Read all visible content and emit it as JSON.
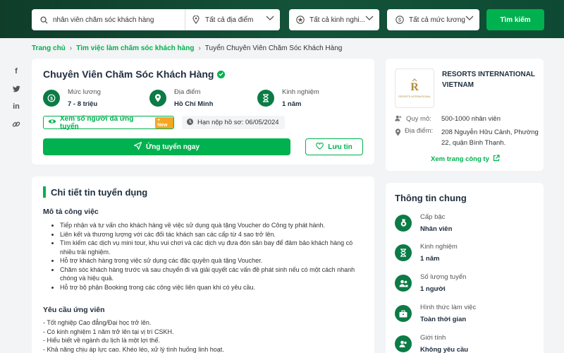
{
  "search": {
    "keyword": "nhân viên chăm sóc khách hàng",
    "location": "Tất cả địa điểm",
    "industry": "Tất cả kinh nghi...",
    "salary": "Tất cả mức lương",
    "button": "Tìm kiếm"
  },
  "breadcrumb": [
    "Trang chủ",
    "Tìm việc làm chăm sóc khách hàng",
    "Tuyển Chuyên Viên Chăm Sóc Khách Hàng"
  ],
  "job": {
    "title": "Chuyên Viên Chăm Sóc Khách Hàng",
    "stats": [
      {
        "label": "Mức lương",
        "value": "7 - 8 triệu",
        "icon": "salary-icon"
      },
      {
        "label": "Địa điểm",
        "value": "Hồ Chí Minh",
        "icon": "location-icon"
      },
      {
        "label": "Kinh nghiệm",
        "value": "1 năm",
        "icon": "hourglass-icon"
      }
    ],
    "view_applicants": "Xem số người đã ứng tuyển",
    "new_badge": "New",
    "deadline": "Hạn nộp hồ sơ: 06/05/2024",
    "apply": "Ứng tuyển ngay",
    "save": "Lưu tin"
  },
  "detail": {
    "heading": "Chi tiết tin tuyển dụng",
    "desc_title": "Mô tả công việc",
    "desc_items": [
      "Tiếp nhận và tư vấn cho khách hàng về việc sử dụng quà tặng Voucher do Công ty phát hành.",
      "Liên kết và thương lượng với các đối tác khách sạn các cấp từ 4 sao trở lên.",
      "Tìm kiếm các dịch vụ mini tour, khu vui chơi và các dịch vụ đưa đón sân bay để đảm bảo khách hàng có nhiều trải nghiệm.",
      "Hỗ trợ khách hàng trong việc sử dụng các đặc quyền quà tặng Voucher.",
      "Chăm sóc khách hàng trước và sau chuyến đi và giải quyết các vấn đề phát sinh nếu có một cách nhanh chóng và hiệu quả.",
      "Hỗ trợ bộ phận Booking trong các công việc liên quan khi có yêu cầu."
    ],
    "req_title": "Yêu cầu ứng viên",
    "req_items": [
      "- Tốt nghiệp Cao đẳng/Đại học trở lên.",
      "- Có kinh nghiệm 1 năm trở lên tại vị trí CSKH.",
      "- Hiểu biết về ngành du lịch là một lợi thế.",
      "- Khả năng chịu áp lực cao. Khéo léo, xử lý tình huống linh hoạt."
    ]
  },
  "company": {
    "name": "RESORTS INTERNATIONAL VIETNAM",
    "logo_text": "RESORTS INTERNATIONAL",
    "size_label": "Quy mô:",
    "size": "500-1000 nhân viên",
    "address_label": "Địa điểm:",
    "address": "208 Nguyễn Hữu Cảnh, Phường 22, quận Bình Thạnh.",
    "link": "Xem trang công ty"
  },
  "general": {
    "title": "Thông tin chung",
    "items": [
      {
        "label": "Cấp bậc",
        "value": "Nhân viên",
        "icon": "rank-icon"
      },
      {
        "label": "Kinh nghiệm",
        "value": "1 năm",
        "icon": "hourglass-icon"
      },
      {
        "label": "Số lượng tuyển",
        "value": "1 người",
        "icon": "people-icon"
      },
      {
        "label": "Hình thức làm việc",
        "value": "Toàn thời gian",
        "icon": "briefcase-icon"
      },
      {
        "label": "Giới tính",
        "value": "Không yêu cầu",
        "icon": "gender-icon"
      }
    ]
  },
  "colors": {
    "brand": "#00b14f",
    "dark": "#0c7b46",
    "header": "#14533a"
  }
}
